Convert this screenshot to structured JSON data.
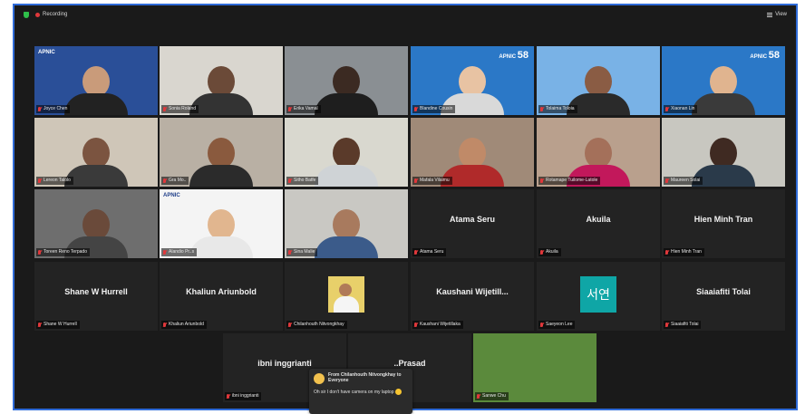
{
  "topbar": {
    "recording_label": "Recording",
    "view_label": "View"
  },
  "participants": [
    {
      "name": "Joyce Chen",
      "bg": "#2a4f98",
      "apnic": "APNIC"
    },
    {
      "name": "Sonia Roland",
      "bg": "#d9d6cf",
      "speaking": true
    },
    {
      "name": "Erika Vamal",
      "bg": "#8a8f93"
    },
    {
      "name": "Blandine Cousin",
      "bg": "#2b78c7",
      "badge": "APNIC 58"
    },
    {
      "name": "Tolaima Toloia",
      "bg": "#79b2e6"
    },
    {
      "name": "Xiaonan Lin",
      "bg": "#2b78c7",
      "badge": "APNIC 58"
    },
    {
      "name": "Lereon Talolo",
      "bg": "#cfc6b8"
    },
    {
      "name": "Gra Mo..",
      "bg": "#b9b0a4"
    },
    {
      "name": "Sitho Batfe",
      "bg": "#d9d8cf"
    },
    {
      "name": "Mafala Vilaimu",
      "bg": "#a08a78"
    },
    {
      "name": "Rotamape Tuilome-Latole",
      "bg": "#b9a08d"
    },
    {
      "name": "Maureen Solai",
      "bg": "#c8c7c0"
    },
    {
      "name": "Toreen Reno Terpado",
      "bg": "#6e6e6e"
    },
    {
      "name": "Alandio Pr..s",
      "bg": "#f4f4f4",
      "apnic": "APNIC"
    },
    {
      "name": "Sina Malie",
      "bg": "#c9c8c3"
    },
    {
      "name": "Atama Seru",
      "bg": "#232323",
      "bigname": "Atama Seru"
    },
    {
      "name": "Akuila",
      "bg": "#232323",
      "bigname": "Akuila"
    },
    {
      "name": "Hien Minh Tran",
      "bg": "#232323",
      "bigname": "Hien Minh Tran"
    },
    {
      "name": "Shane W Hurrell",
      "bg": "#232323",
      "bigname": "Shane W Hurrell"
    },
    {
      "name": "Khaliun Ariunbold",
      "bg": "#232323",
      "bigname": "Khaliun Ariunbold"
    },
    {
      "name": "Chilanhouth Nitvongkhay",
      "bg": "#232323",
      "thumb": true
    },
    {
      "name": "Kaushani Wijetillaka",
      "bg": "#232323",
      "bigname": "Kaushani  Wijetill..."
    },
    {
      "name": "Saeyeon Lee",
      "bg": "#232323",
      "korean": "서연"
    },
    {
      "name": "Siaaiafiti Tolai",
      "bg": "#232323",
      "bigname": "Siaaiafiti Tolai"
    },
    {
      "name": "ibni inggrianti",
      "bg": "#232323",
      "bigname": "ibni inggrianti"
    },
    {
      "name": "",
      "bg": "#232323",
      "bigname": "..Prasad"
    },
    {
      "name": "Sanwe Chu",
      "bg": "#5b8a3c"
    }
  ],
  "chat": {
    "from": "From Chilanhouth Nitvongkhay to Everyone",
    "message": "Oh sir I don't have camera on my laptop"
  },
  "colors": {
    "window_border": "#2f6bd8",
    "speaking_outline": "#a8d645",
    "mic_muted": "#e0383b"
  }
}
